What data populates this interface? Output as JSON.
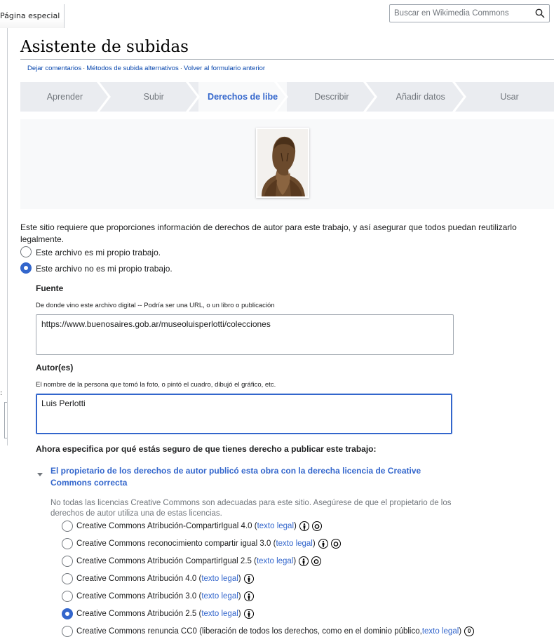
{
  "header": {
    "special_tab": "Página especial",
    "search_placeholder": "Buscar en Wikimedia Commons"
  },
  "page": {
    "title": "Asistente de subidas",
    "subnav": [
      "Dejar comentarios",
      "Métodos de subida alternativos",
      "Volver al formulario anterior"
    ]
  },
  "steps": [
    {
      "label": "Aprender",
      "active": false
    },
    {
      "label": "Subir",
      "active": false
    },
    {
      "label": "Derechos de libe",
      "active": true
    },
    {
      "label": "Describir",
      "active": false
    },
    {
      "label": "Añadir datos",
      "active": false
    },
    {
      "label": "Usar",
      "active": false
    }
  ],
  "intro_text": "Este sitio requiere que proporciones información de derechos de autor para este trabajo, y así asegurar que todos puedan reutilizarlo legalmente.",
  "ownership": {
    "own_work": "Este archivo es mi propio trabajo.",
    "not_own_work": "Este archivo no es mi propio trabajo.",
    "selected": "not_own_work"
  },
  "source": {
    "label": "Fuente",
    "hint": "De donde vino este archivo digital -- Podría ser una URL, o un libro o publicación",
    "value": "https://www.buenosaires.gob.ar/museoluisperlotti/colecciones"
  },
  "author": {
    "label": "Autor(es)",
    "hint": "El nombre de la persona que tomó la foto, o pintó el cuadro, dibujó el gráfico, etc.",
    "value": "Luis Perlotti"
  },
  "rights": {
    "question": "Ahora especifica por qué estás seguro de que tienes derecho a publicar este trabajo:",
    "option_title": "El propietario de los derechos de autor publicó esta obra con la derecha licencia de Creative Commons correcta",
    "note": "No todas las licencias Creative Commons son adecuadas para este sitio. Asegúrese de que el propietario de los derechos de autor utiliza una de estas licencias.",
    "legal_text": "texto legal",
    "licenses": [
      {
        "name": "Creative Commons Atribución-CompartirIgual 4.0",
        "icons": [
          "by",
          "sa"
        ],
        "selected": false
      },
      {
        "name": "Creative Commons reconocimiento compartir igual 3.0",
        "icons": [
          "by",
          "sa"
        ],
        "selected": false
      },
      {
        "name": "Creative Commons Atribución CompartirIgual 2.5",
        "icons": [
          "by",
          "sa"
        ],
        "selected": false
      },
      {
        "name": "Creative Commons Atribución 4.0",
        "icons": [
          "by"
        ],
        "selected": false
      },
      {
        "name": "Creative Commons Atribución 3.0",
        "icons": [
          "by"
        ],
        "selected": false
      },
      {
        "name": "Creative Commons Atribución 2.5",
        "icons": [
          "by"
        ],
        "selected": true
      }
    ],
    "cc0": {
      "name": "Creative Commons renuncia CC0 (liberación de todos los derechos, como en el dominio público, ",
      "link": "texto legal",
      "tail": ")",
      "icon_text": "0"
    }
  },
  "colors": {
    "accent": "#3366cc",
    "link": "#0645ad",
    "muted": "#72777d",
    "step_bg": "#eaecf0"
  }
}
